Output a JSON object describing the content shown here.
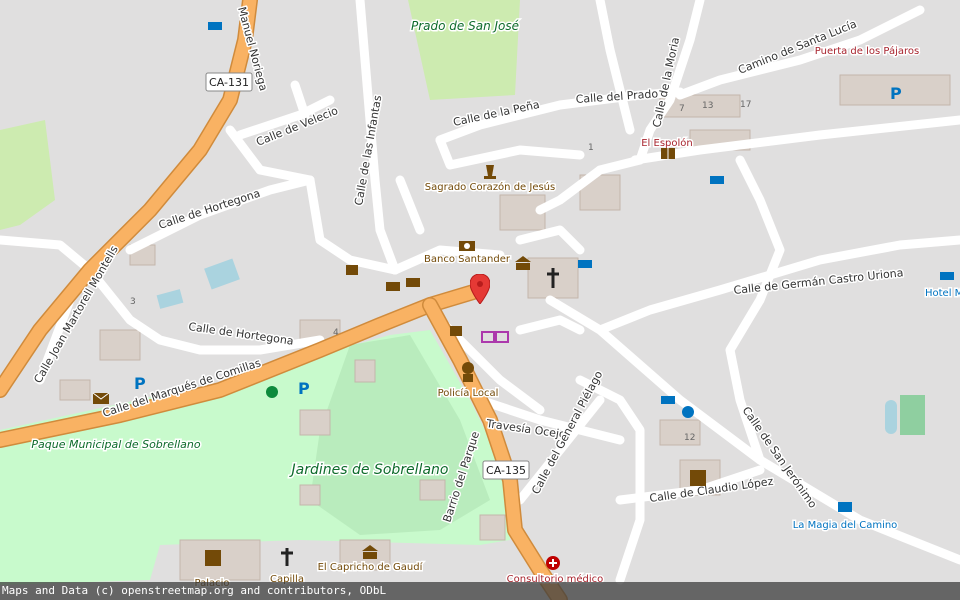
{
  "colors": {
    "background": "#e0dfdf",
    "park": "#c8facc",
    "meadow": "#cdebb0",
    "primary_road": "#f9b263",
    "road": "#ffffff",
    "building": "#d9d0c9",
    "water": "#aad3df",
    "marker": "#e53935"
  },
  "roads": {
    "ca131": "CA-131",
    "ca135": "CA-135",
    "manuel_noriega": "Manuel Noriega",
    "velecio": "Calle de Velecio",
    "infantas": "Calle de las Infantas",
    "hortegona_upper": "Calle de Hortegona",
    "hortegona_lower": "Calle de Hortegona",
    "pena": "Calle de la Peña",
    "prado": "Calle del Prado",
    "moria": "Calle de la Moria",
    "santa_lucia": "Camino de Santa Lucía",
    "joan_martorell": "Calle Joan Martorell Montells",
    "marques": "Calle del Marqués de Comillas",
    "german_castro": "Calle de Germán Castro Uriona",
    "ocejo": "Travesía Ocejo",
    "general_pielago": "Calle del General Piélago",
    "san_jeronimo": "Calle de San Jerónimo",
    "claudio_lopez": "Calle de Claudio López",
    "barrio_parque": "Barrio del Parque"
  },
  "places": {
    "prado_san_jose": "Prado de San José",
    "puerta_pajaros": "Puerta de los Pájaros",
    "el_espolon": "El Espolón",
    "sagrado_corazon": "Sagrado Corazón de Jesús",
    "banco_santander": "Banco Santander",
    "policia_local": "Policía Local",
    "parque_sobrellano": "Paque Municipal de Sobrellano",
    "jardines_sobrellano": "Jardines de Sobrellano",
    "hotel": "Hotel M Comillas",
    "la_magia": "La Magia del Camino",
    "capricho": "El Capricho de Gaudí",
    "consultorio": "Consultorio médico",
    "capilla": "Capilla",
    "palacio": "Palacio"
  },
  "house_numbers": [
    "3",
    "4",
    "1",
    "7",
    "13",
    "17",
    "12"
  ],
  "icons": [
    "church-icon",
    "bank-icon",
    "parking-icon",
    "hotel-icon",
    "police-icon",
    "museum-icon",
    "library-icon",
    "shop-icon",
    "post-icon",
    "playground-icon",
    "monument-icon",
    "pharmacy-icon",
    "map-marker-icon"
  ],
  "attribution": "Maps and Data (c) openstreetmap.org and contributors, ODbL"
}
